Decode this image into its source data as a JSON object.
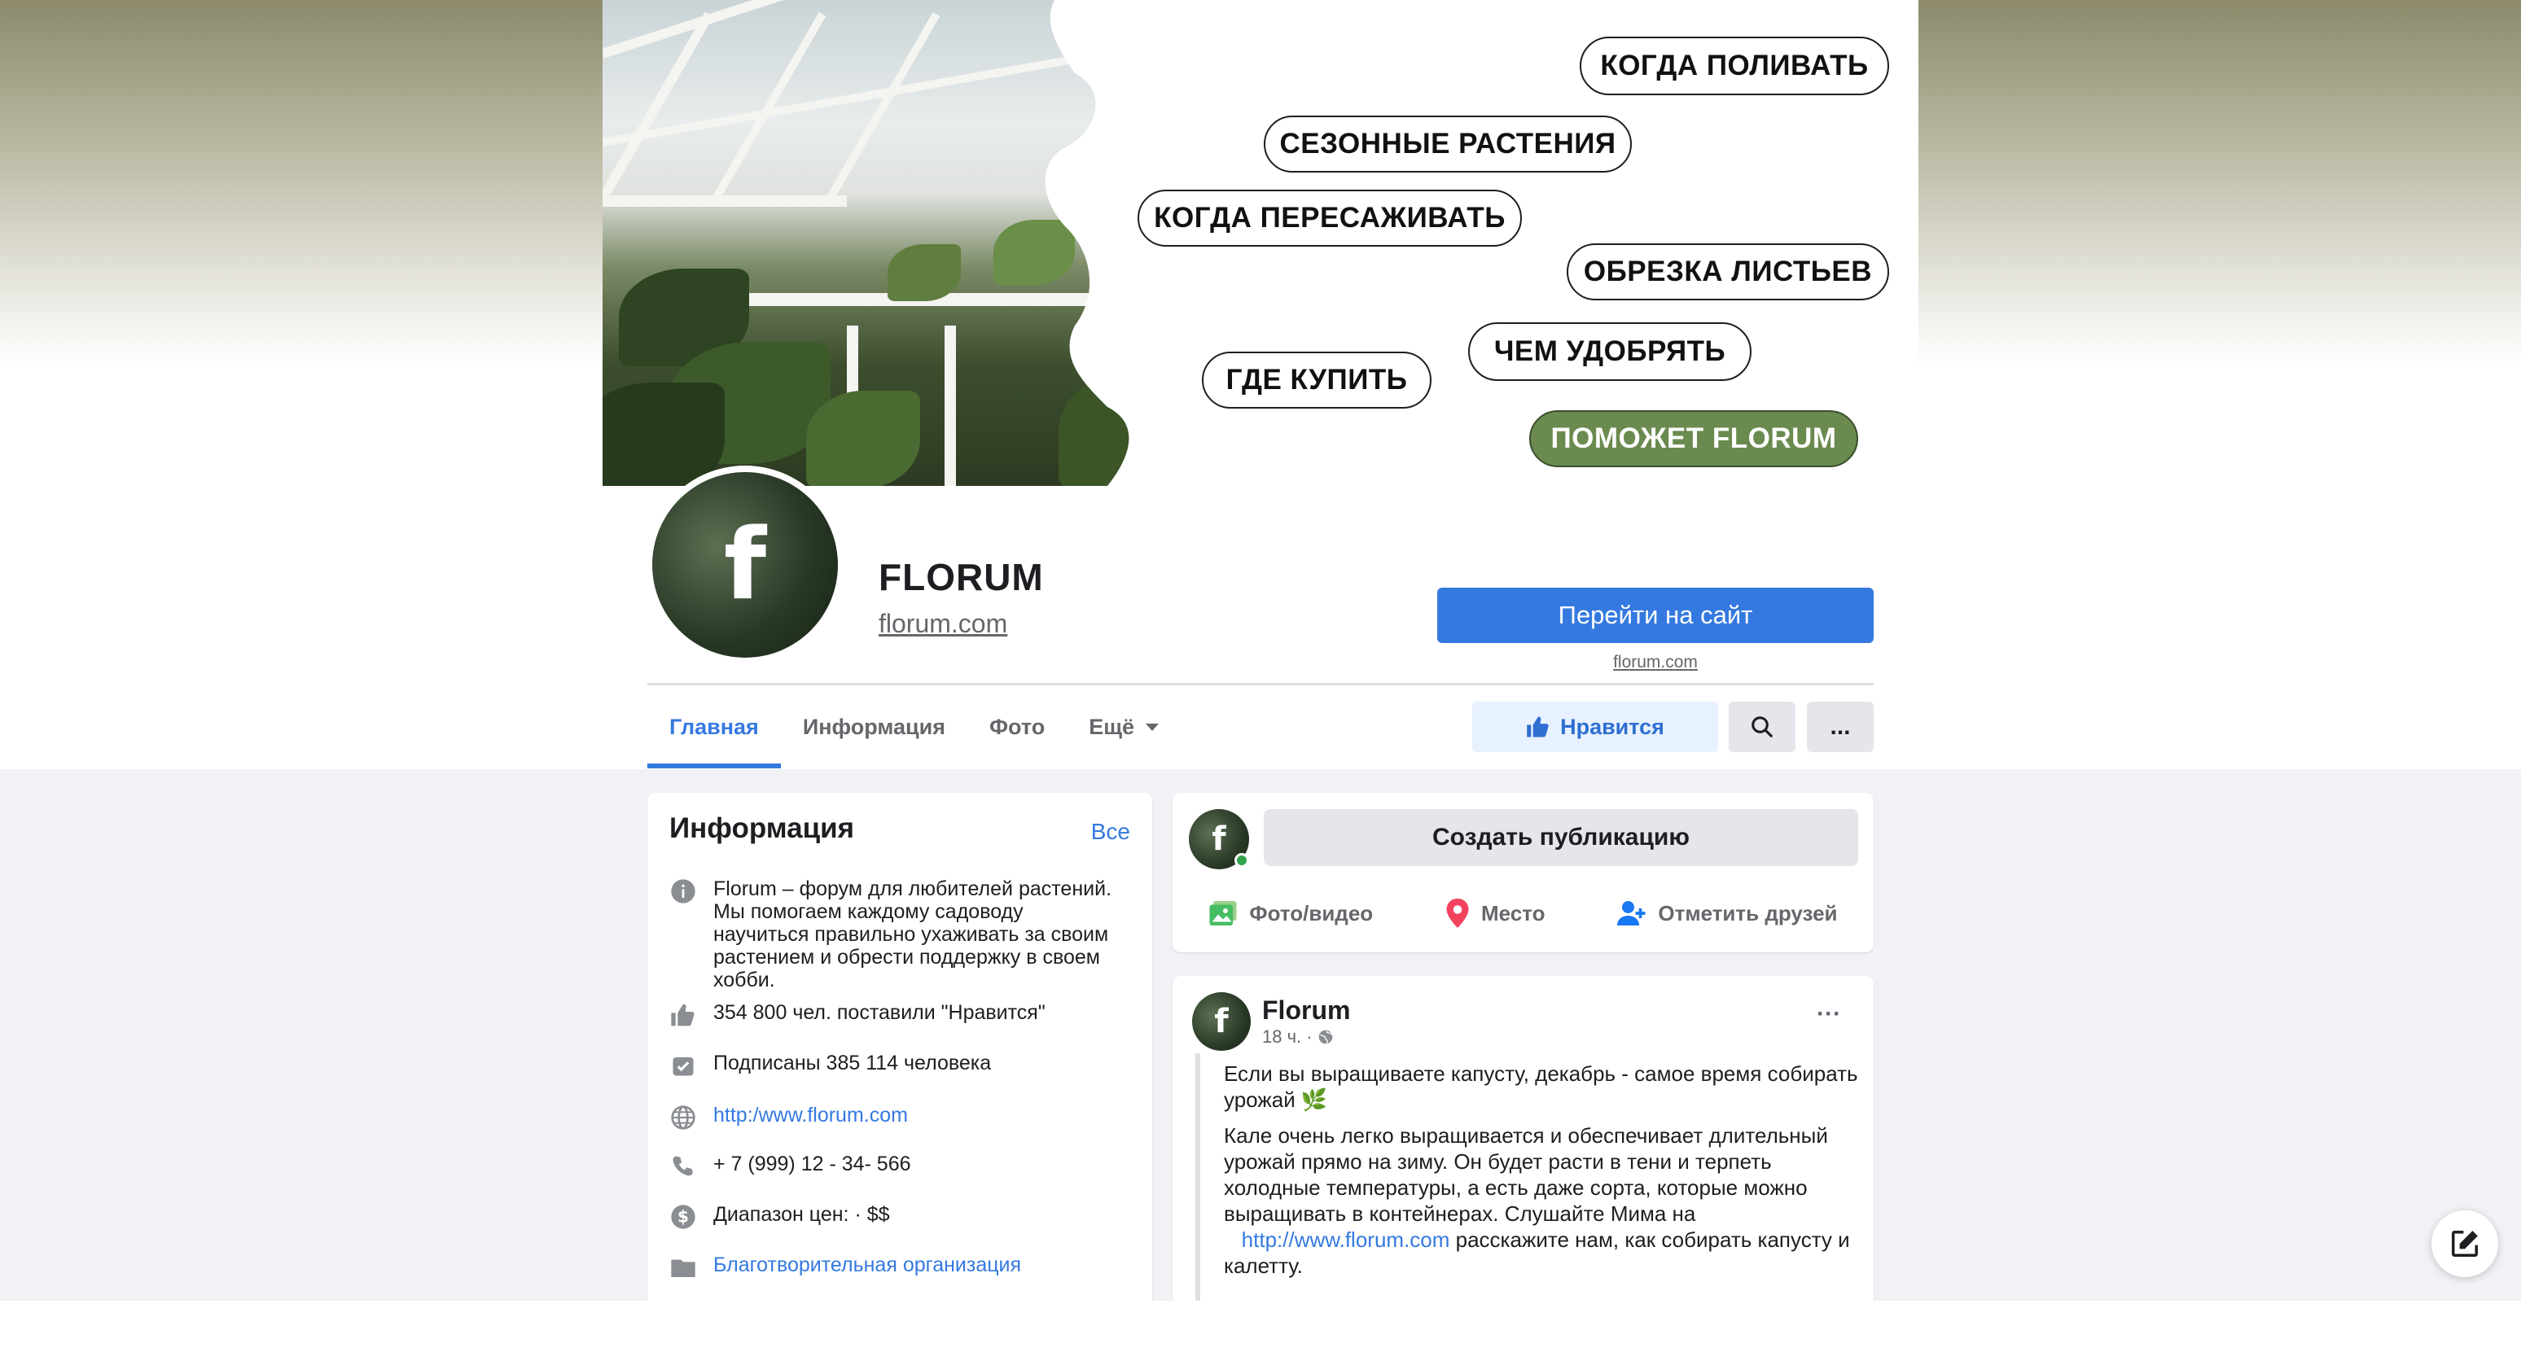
{
  "cover": {
    "pills": [
      {
        "label": "КОГДА ПОЛИВАТЬ"
      },
      {
        "label": "СЕЗОННЫЕ РАСТЕНИЯ"
      },
      {
        "label": "КОГДА ПЕРЕСАЖИВАТЬ"
      },
      {
        "label": "ОБРЕЗКА ЛИСТЬЕВ"
      },
      {
        "label": "ЧЕМ УДОБРЯТЬ"
      },
      {
        "label": "ГДЕ КУПИТЬ"
      },
      {
        "label": "ПОМОЖЕТ FLORUM"
      }
    ],
    "accent_color": "#6a8a4f"
  },
  "profile": {
    "avatar_letter": "f",
    "name": "FLORUM",
    "handle": "florum.com",
    "site_button": "Перейти на сайт",
    "site_caption": "florum.com"
  },
  "nav": {
    "tabs": [
      {
        "label": "Главная",
        "active": true
      },
      {
        "label": "Информация"
      },
      {
        "label": "Фото"
      },
      {
        "label": "Ещё"
      }
    ],
    "like_label": "Нравится",
    "more_label": "..."
  },
  "info": {
    "title": "Информация",
    "all_link": "Все",
    "about": "Florum – форум для любителей растений. Мы помогаем каждому садоводу научиться правильно ухаживать за своим растением и обрести поддержку в своем хобби.",
    "likes": "354 800 чел. поставили \"Нравится\"",
    "followers": "Подписаны 385 114 человека",
    "website": "http:/www.florum.com",
    "phone": "+ 7 (999) 12 - 34- 566",
    "price": "Диапазон цен: · $$",
    "category": "Благотворительная организация"
  },
  "create": {
    "avatar_letter": "f",
    "button": "Создать публикацию",
    "actions": [
      {
        "label": "Фото/видео"
      },
      {
        "label": "Место"
      },
      {
        "label": "Отметить друзей"
      }
    ]
  },
  "post": {
    "avatar_letter": "f",
    "author": "Florum",
    "time": "18 ч. ·",
    "more": "···",
    "p1": "Если вы выращиваете капусту, декабрь - самое время собирать урожай 🌿",
    "p2_before": "Кале очень легко выращивается и обеспечивает длительный урожай прямо на зиму. Он будет расти в тени и терпеть холодные температуры, а есть даже сорта, которые можно выращивать в контейнерах. Слушайте Мима на",
    "p2_link": "http://www.florum.com",
    "p2_after": "расскажите нам, как собирать капусту и калетту."
  }
}
